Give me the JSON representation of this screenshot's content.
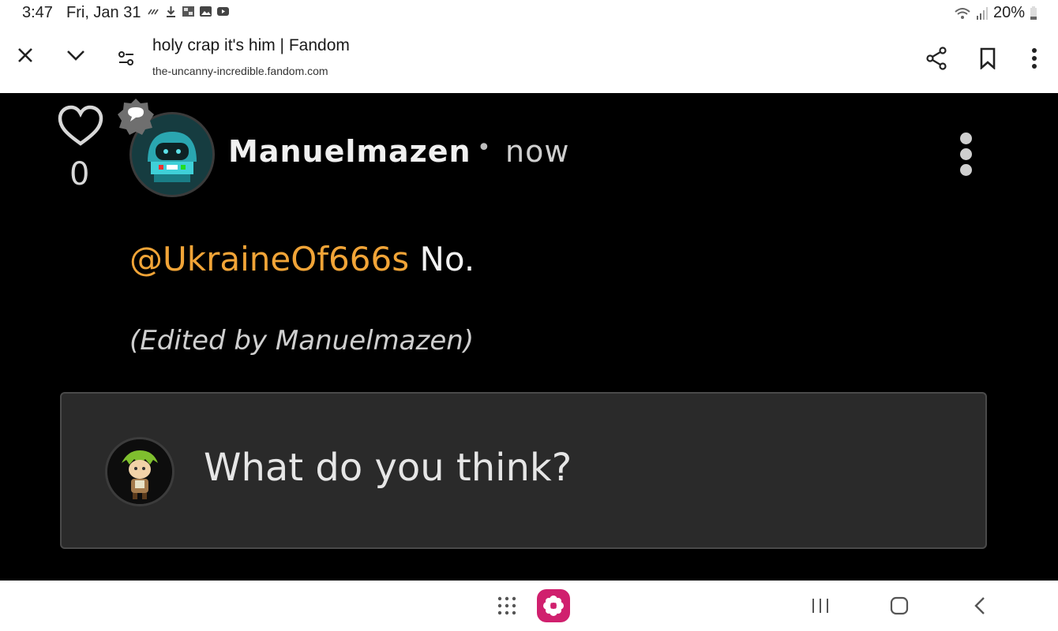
{
  "status_bar": {
    "time": "3:47",
    "date": "Fri, Jan 31",
    "battery": "20%",
    "icons": [
      "assistant-icon",
      "download-icon",
      "gallery-icon",
      "photo-icon",
      "youtube-icon",
      "wifi-icon",
      "signal-icon",
      "battery-icon"
    ]
  },
  "toolbar": {
    "tab_title": "holy crap it's him | Fandom",
    "tab_url": "the-uncanny-incredible.fandom.com"
  },
  "post": {
    "like_count": "0",
    "author": "Manuelmazen",
    "separator": "•",
    "timestamp": "now",
    "mention": "@UkraineOf666s",
    "message": " No.",
    "edited_note": "(Edited by Manuelmazen)"
  },
  "reply": {
    "placeholder": "What do you think?"
  },
  "colors": {
    "mention": "#f1a437",
    "background": "#000000",
    "reply_box": "#2a2a2a",
    "app_icon": "#d0206e"
  }
}
